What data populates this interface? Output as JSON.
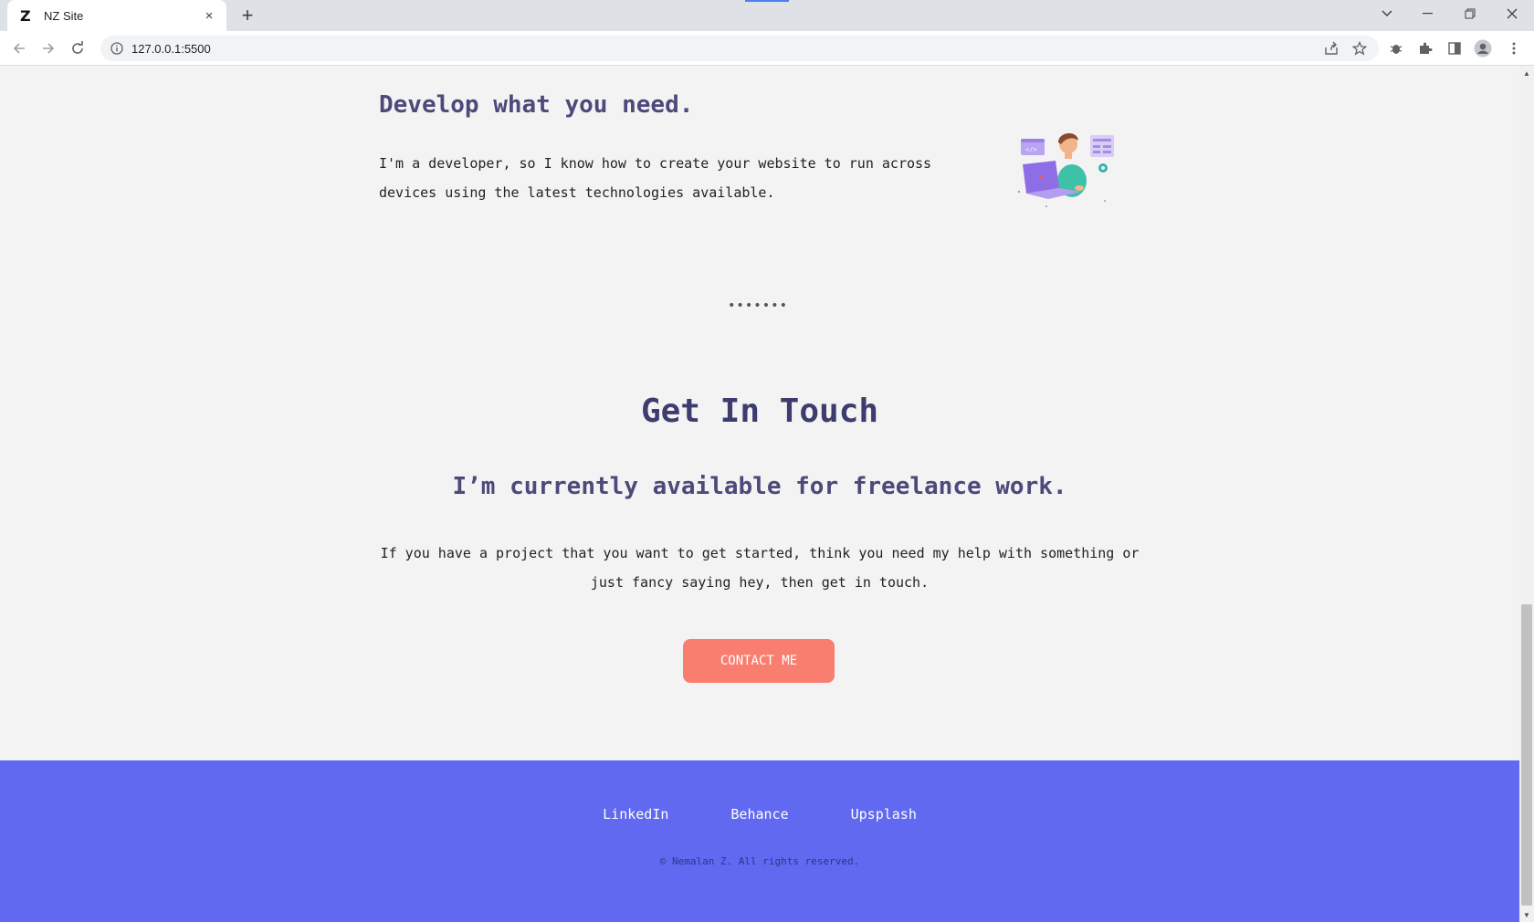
{
  "browser": {
    "tab_title": "NZ Site",
    "tab_favicon": "Z",
    "url": "127.0.0.1:5500",
    "new_tab_symbol": "+",
    "tab_close_symbol": "×",
    "accent_color": "#4a80f0"
  },
  "develop": {
    "heading": "Develop what you need.",
    "text": "I'm a developer, so I know how to create your website to run across devices using the latest technologies available.",
    "illustration_icon": "developer-with-laptop-illustration"
  },
  "separator": "•••••••",
  "contact": {
    "title": "Get In Touch",
    "subtitle": "I’m currently available for freelance work.",
    "text": "If you have a project that you want to get started, think you need my help with something or just fancy saying hey, then get in touch.",
    "button_label": "CONTACT ME",
    "button_color": "#f97e70"
  },
  "footer": {
    "background": "#6069f0",
    "links": [
      "LinkedIn",
      "Behance",
      "Upsplash"
    ],
    "copyright": "© Nemalan Z. All rights reserved."
  }
}
